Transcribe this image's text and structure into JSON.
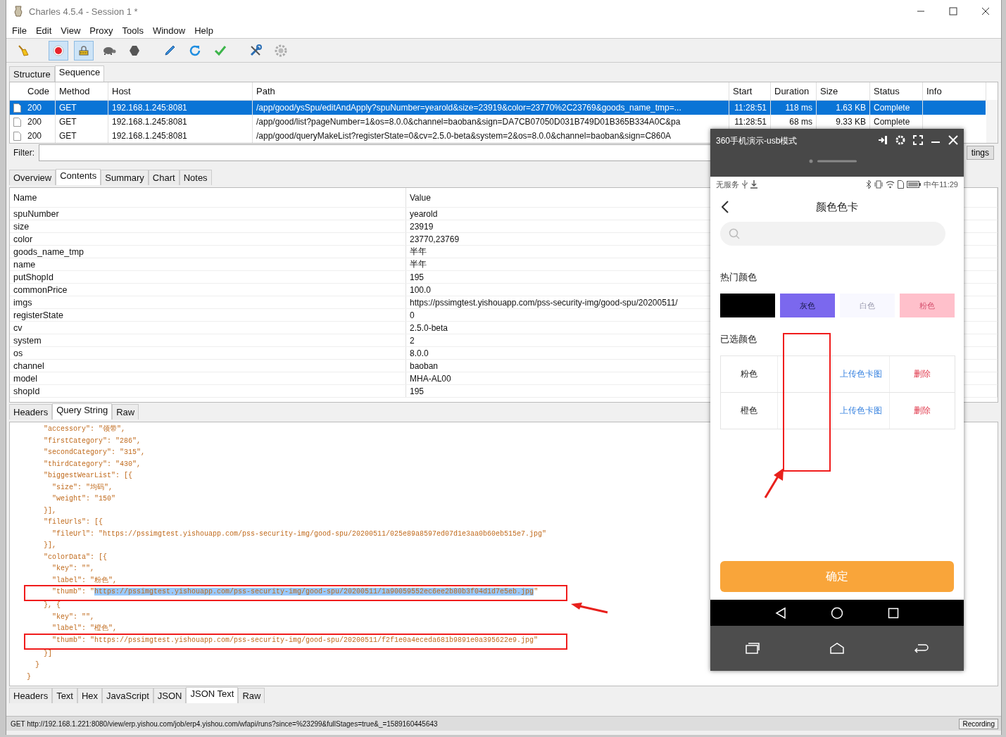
{
  "window": {
    "title": "Charles 4.5.4 - Session 1 *"
  },
  "menu": [
    "File",
    "Edit",
    "View",
    "Proxy",
    "Tools",
    "Window",
    "Help"
  ],
  "toolbar": [
    {
      "kind": "broom",
      "selected": false
    },
    {
      "kind": "record",
      "selected": true
    },
    {
      "kind": "lock",
      "selected": true
    },
    {
      "kind": "turtle",
      "selected": false
    },
    {
      "kind": "stop",
      "selected": false
    },
    {
      "kind": "pen",
      "selected": false
    },
    {
      "kind": "refresh",
      "selected": false
    },
    {
      "kind": "check",
      "selected": false
    },
    {
      "kind": "tools",
      "selected": false
    },
    {
      "kind": "gear",
      "selected": false
    }
  ],
  "session_tabs": [
    {
      "label": "Structure",
      "selected": false
    },
    {
      "label": "Sequence",
      "selected": true
    }
  ],
  "table": {
    "columns": [
      "Code",
      "Method",
      "Host",
      "Path",
      "Start",
      "Duration",
      "Size",
      "Status",
      "Info"
    ],
    "rows": [
      {
        "selected": true,
        "cells": [
          "200",
          "GET",
          "192.168.1.245:8081",
          "/app/good/ysSpu/editAndApply?spuNumber=yearold&size=23919&color=23770%2C23769&goods_name_tmp=...",
          "11:28:51",
          "118 ms",
          "1.63 KB",
          "Complete",
          ""
        ]
      },
      {
        "selected": false,
        "cells": [
          "200",
          "GET",
          "192.168.1.245:8081",
          "/app/good/list?pageNumber=1&os=8.0.0&channel=baoban&sign=DA7CB07050D031B749D01B365B334A0C&pa",
          "11:28:51",
          "68 ms",
          "9.33 KB",
          "Complete",
          ""
        ]
      },
      {
        "selected": false,
        "cells": [
          "200",
          "GET",
          "192.168.1.245:8081",
          "/app/good/queryMakeList?registerState=0&cv=2.5.0-beta&system=2&os=8.0.0&channel=baoban&sign=C860A"
        ]
      }
    ]
  },
  "filter": {
    "label": "Filter:",
    "button": "tings"
  },
  "detail_tabs": [
    {
      "label": "Overview",
      "selected": false
    },
    {
      "label": "Contents",
      "selected": true
    },
    {
      "label": "Summary",
      "selected": false
    },
    {
      "label": "Chart",
      "selected": false
    },
    {
      "label": "Notes",
      "selected": false
    }
  ],
  "params": {
    "columns": [
      "Name",
      "Value"
    ],
    "rows": [
      [
        "spuNumber",
        "yearold"
      ],
      [
        "size",
        "23919"
      ],
      [
        "color",
        "23770,23769"
      ],
      [
        "goods_name_tmp",
        "半年"
      ],
      [
        "name",
        "半年"
      ],
      [
        "putShopId",
        "195"
      ],
      [
        "commonPrice",
        "100.0"
      ],
      [
        "imgs",
        "https://pssimgtest.yishouapp.com/pss-security-img/good-spu/20200511/"
      ],
      [
        "registerState",
        "0"
      ],
      [
        "cv",
        "2.5.0-beta"
      ],
      [
        "system",
        "2"
      ],
      [
        "os",
        "8.0.0"
      ],
      [
        "channel",
        "baoban"
      ],
      [
        "model",
        "MHA-AL00"
      ],
      [
        "shopId",
        "195"
      ]
    ]
  },
  "request_tabs": [
    {
      "label": "Headers",
      "selected": false
    },
    {
      "label": "Query String",
      "selected": true
    },
    {
      "label": "Raw",
      "selected": false
    }
  ],
  "code_lines": [
    {
      "text": "    \"accessory\": \"领带\",",
      "highlighted": false
    },
    {
      "text": "    \"firstCategory\": \"286\",",
      "highlighted": false
    },
    {
      "text": "    \"secondCategory\": \"315\",",
      "highlighted": false
    },
    {
      "text": "    \"thirdCategory\": \"430\",",
      "highlighted": false
    },
    {
      "text": "    \"biggestWearList\": [{",
      "highlighted": false
    },
    {
      "text": "      \"size\": \"均码\",",
      "highlighted": false
    },
    {
      "text": "      \"weight\": \"150\"",
      "highlighted": false
    },
    {
      "text": "    }],",
      "highlighted": false
    },
    {
      "text": "    \"fileUrls\": [{",
      "highlighted": false
    },
    {
      "text": "      \"fileUrl\": \"https://pssimgtest.yishouapp.com/pss-security-img/good-spu/20200511/025e89a8597ed07d1e3aa0b60eb515e7.jpg\"",
      "highlighted": false
    },
    {
      "text": "    }],",
      "highlighted": false
    },
    {
      "text": "    \"colorData\": [{",
      "highlighted": false
    },
    {
      "text": "      \"key\": \"\",",
      "highlighted": false
    },
    {
      "text": "      \"label\": \"粉色\",",
      "highlighted": false
    },
    {
      "text": "      \"thumb\": \"",
      "selection": "https://pssimgtest.yishouapp.com/pss-security-img/good-spu/20200511/1a90059552ec6ee2b80b3f04d1d7e5eb.jpg",
      "after": "\"",
      "highlighted": true
    },
    {
      "text": "    }, {",
      "highlighted": false
    },
    {
      "text": "      \"key\": \"\",",
      "highlighted": false
    },
    {
      "text": "      \"label\": \"橙色\",",
      "highlighted": false
    },
    {
      "text": "      \"thumb\": \"https://pssimgtest.yishouapp.com/pss-security-img/good-spu/20200511/f2f1e0a4eceda681b9891e0a395622e9.jpg\"",
      "highlighted": true
    },
    {
      "text": "    }]",
      "highlighted": false
    },
    {
      "text": "  }",
      "highlighted": false
    },
    {
      "text": "}",
      "highlighted": false
    }
  ],
  "response_tabs": [
    {
      "label": "Headers",
      "selected": false
    },
    {
      "label": "Text",
      "selected": false
    },
    {
      "label": "Hex",
      "selected": false
    },
    {
      "label": "JavaScript",
      "selected": false
    },
    {
      "label": "JSON",
      "selected": false
    },
    {
      "label": "JSON Text",
      "selected": true
    },
    {
      "label": "Raw",
      "selected": false
    }
  ],
  "status_bar": {
    "text": "GET http://192.168.1.221:8080/view/erp.yishou.com/job/erp4.yishou.com/wfapi/runs?since=%23299&fullStages=true&_=1589160445643",
    "button": "Recording"
  },
  "phone": {
    "title": "360手机演示-usb模式",
    "status_left": "无服务",
    "status_time": "中午11:29",
    "page_title": "颜色色卡",
    "hot_heading": "热门颜色",
    "swatches": [
      {
        "color": "#000000"
      },
      {
        "label": "灰色",
        "color": "#7b68ee"
      },
      {
        "label": "白色",
        "color": "#f8f8ff"
      },
      {
        "label": "粉色",
        "color": "#ffc0cb"
      }
    ],
    "selected_heading": "已选颜色",
    "selected_rows": [
      {
        "name": "粉色",
        "upload": "上传色卡图",
        "delete": "删除"
      },
      {
        "name": "橙色",
        "upload": "上传色卡图",
        "delete": "删除"
      }
    ],
    "confirm": "确定"
  }
}
